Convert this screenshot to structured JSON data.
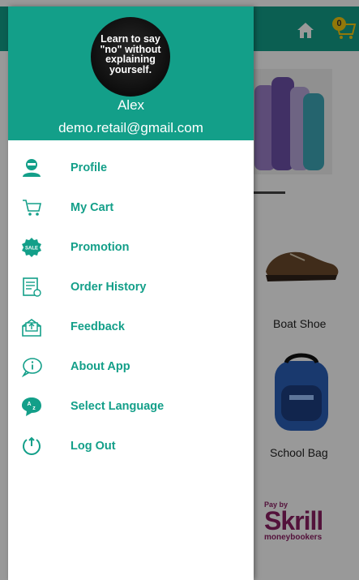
{
  "colors": {
    "primary": "#139f89",
    "badge": "#f4c90f",
    "skrill": "#8b1e63"
  },
  "background": {
    "cart_count": "0",
    "products": [
      {
        "name": "Boat Shoe"
      },
      {
        "name": "School Bag"
      }
    ],
    "payment_banner": {
      "line1": "Pay by",
      "brand": "Skrill",
      "line2": "moneybookers"
    }
  },
  "drawer": {
    "avatar_text": "Learn to say \"no\" without explaining yourself.",
    "user_name": "Alex",
    "user_email": "demo.retail@gmail.com",
    "items": [
      {
        "label": "Profile",
        "icon": "profile-icon"
      },
      {
        "label": "My Cart",
        "icon": "cart-icon"
      },
      {
        "label": "Promotion",
        "icon": "sale-badge-icon"
      },
      {
        "label": "Order History",
        "icon": "order-history-icon"
      },
      {
        "label": "Feedback",
        "icon": "feedback-icon"
      },
      {
        "label": "About App",
        "icon": "info-icon"
      },
      {
        "label": "Select Language",
        "icon": "language-icon"
      },
      {
        "label": "Log Out",
        "icon": "logout-icon"
      }
    ]
  }
}
